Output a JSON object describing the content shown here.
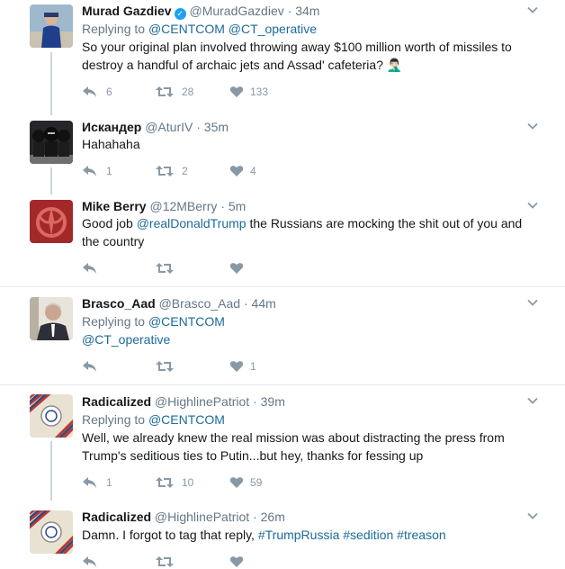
{
  "tweets": [
    {
      "name": "Murad Gazdiev",
      "verified": true,
      "handle": "@MuradGazdiev",
      "time": "34m",
      "replying_prefix": "Replying to",
      "replying_to": "@CENTCOM @CT_operative",
      "text_lines": [
        "So your original plan involved throwing away $100 million worth of missiles to",
        "destroy a handful of archaic jets and Assad' cafeteria? 🤦🏻‍♂️"
      ],
      "replies": "6",
      "retweets": "28",
      "likes": "133"
    },
    {
      "name": "Искандер",
      "handle": "@AturIV",
      "time": "35m",
      "text_lines": [
        "Hahahaha"
      ],
      "replies": "1",
      "retweets": "2",
      "likes": "4"
    },
    {
      "name": "Mike Berry",
      "handle": "@12MBerry",
      "time": "5m",
      "text_lines": [
        {
          "pre": "Good job ",
          "link": "@realDonaldTrump",
          "post": " the Russians are mocking the shit out of you and"
        },
        "the country"
      ],
      "replies": "",
      "retweets": "",
      "likes": ""
    },
    {
      "name": "Brasco_Aad",
      "handle": "@Brasco_Aad",
      "time": "44m",
      "replying_prefix": "Replying to",
      "replying_to": "@CENTCOM",
      "text_lines": [
        "@CT_operative"
      ],
      "replies": "",
      "retweets": "",
      "likes": "1"
    },
    {
      "name": "Radicalized",
      "handle": "@HighlinePatriot",
      "time": "39m",
      "replying_prefix": "Replying to",
      "replying_to": "@CENTCOM",
      "text_lines": [
        "Well, we already knew the real mission was about distracting the press from",
        "Trump's seditious ties to Putin...but hey, thanks for fessing up"
      ],
      "replies": "1",
      "retweets": "10",
      "likes": "59"
    },
    {
      "name": "Radicalized",
      "handle": "@HighlinePatriot",
      "time": "26m",
      "text_lines": [
        {
          "pre": "Damn. I forgot to tag that reply, ",
          "link": "#TrumpRussia #sedition #treason",
          "post": ""
        }
      ]
    }
  ],
  "dot": "·",
  "colors": {
    "link": "#1b6a9b",
    "muted": "#657786",
    "action": "#8899a6",
    "verified": "#1da1f2"
  },
  "icons": [
    "reply-icon",
    "retweet-icon",
    "like-icon",
    "caret-down-icon",
    "verified-badge-icon"
  ]
}
